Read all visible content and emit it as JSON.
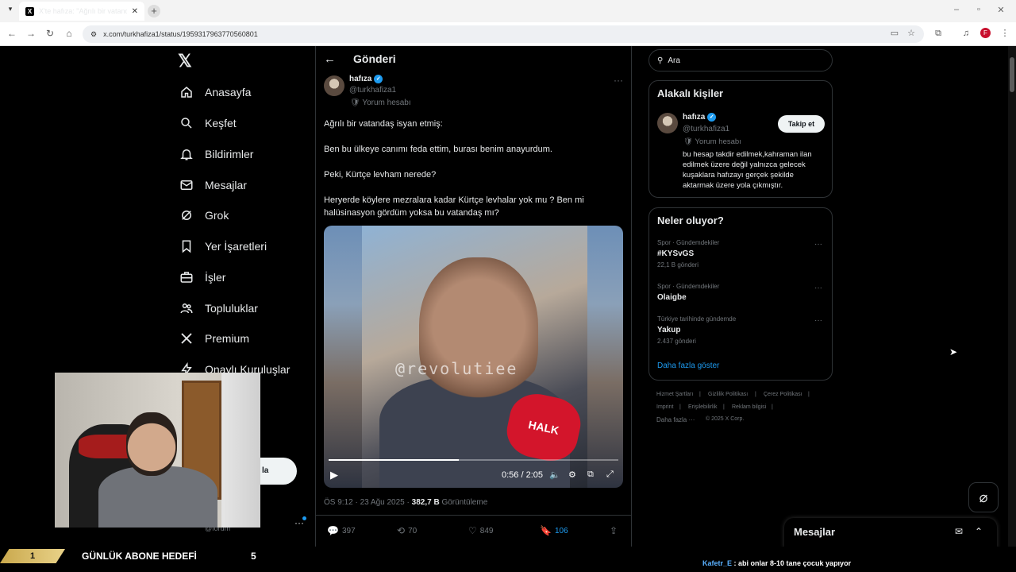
{
  "browser": {
    "tab_title": "X'te hafıza: \"Ağrılı bir vatandaş",
    "tab_favicon": "X",
    "url": "x.com/turkhafiza1/status/1959317963770560801"
  },
  "nav": {
    "items": [
      {
        "label": "Anasayfa",
        "icon": "home-icon"
      },
      {
        "label": "Keşfet",
        "icon": "search-icon"
      },
      {
        "label": "Bildirimler",
        "icon": "bell-icon"
      },
      {
        "label": "Mesajlar",
        "icon": "mail-icon"
      },
      {
        "label": "Grok",
        "icon": "grok-icon"
      },
      {
        "label": "Yer İşaretleri",
        "icon": "bookmark-icon"
      },
      {
        "label": "İşler",
        "icon": "briefcase-icon"
      },
      {
        "label": "Topluluklar",
        "icon": "people-icon"
      },
      {
        "label": "Premium",
        "icon": "x-icon"
      },
      {
        "label": "Onaylı Kuruluşlar",
        "icon": "lightning-icon"
      }
    ],
    "post_button_partial": "la",
    "account_handle_partial": "@forum"
  },
  "post": {
    "header": "Gönderi",
    "author_name": "hafıza",
    "author_handle": "@turkhafiza1",
    "author_badge": "Yorum hesabı",
    "text": [
      "Ağrılı bir vatandaş isyan etmiş:",
      "Ben bu ülkeye canımı feda ettim, burası benim anayurdum.",
      "Peki, Kürtçe levham nerede?",
      "Heryerde köylere mezralara kadar Kürtçe levhalar yok mu ? Ben mi halüsinasyon gördüm yoksa bu vatandaş mı?"
    ],
    "video": {
      "watermark": "@revolutiee",
      "mic_text": "HALK",
      "time": "0:56 / 2:05",
      "progress": 0.45
    },
    "meta_time": "ÖS 9:12 · 23 Ağu 2025 · ",
    "meta_views": "382,7 B",
    "meta_views_label": " Görüntüleme",
    "actions": {
      "replies": "397",
      "reposts": "70",
      "likes": "849",
      "bookmarks": "106"
    }
  },
  "right": {
    "search_placeholder": "Ara",
    "related": {
      "title": "Alakalı kişiler",
      "name": "hafıza",
      "handle": "@turkhafiza1",
      "badge": "Yorum hesabı",
      "follow_label": "Takip et",
      "bio": "bu hesap takdir edilmek,kahraman ilan edilmek üzere değil yalnızca gelecek kuşaklara hafızayı gerçek şekilde aktarmak üzere yola çıkmıştır."
    },
    "trends": {
      "title": "Neler oluyor?",
      "items": [
        {
          "category": "Spor · Gündemdekiler",
          "name": "#KYSvGS",
          "count": "22,1 B gönderi"
        },
        {
          "category": "Spor · Gündemdekiler",
          "name": "Olaigbe",
          "count": ""
        },
        {
          "category": "Türkiye tarihinde gündemde",
          "name": "Yakup",
          "count": "2.437 gönderi"
        }
      ],
      "show_more": "Daha fazla göster"
    },
    "footer": {
      "row1": [
        "Hizmet Şartları",
        "Gizlilik Politikası",
        "Çerez Politikası"
      ],
      "row2": [
        "Imprint",
        "Erişilebilirlik",
        "Reklam bilgisi"
      ],
      "more": "Daha fazla ···",
      "copyright": "© 2025 X Corp."
    }
  },
  "dm": {
    "title": "Mesajlar"
  },
  "stream": {
    "goal_current": "1",
    "goal_label": "GÜNLÜK ABONE HEDEFİ",
    "goal_target": "5",
    "chat_user": "Kafetr_E",
    "chat_message": " : abi onlar 8-10 tane çocuk yapıyor"
  }
}
